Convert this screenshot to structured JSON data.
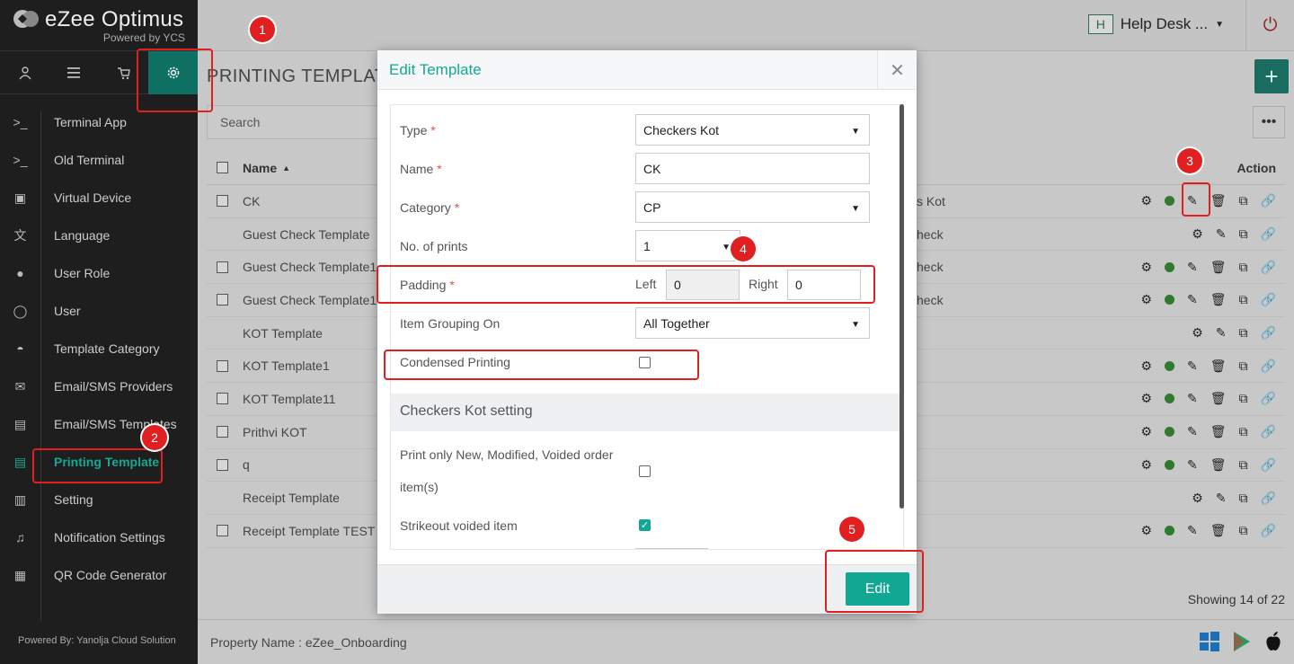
{
  "brand": {
    "name": "eZee Optimus",
    "tagline": "Powered by YCS",
    "powered_by": "Powered By: Yanolja Cloud Solution"
  },
  "top_tabs": [
    {
      "icon": "user-icon"
    },
    {
      "icon": "menu-icon"
    },
    {
      "icon": "cart-icon"
    },
    {
      "icon": "gear-icon",
      "active": true
    }
  ],
  "sidebar": {
    "items": [
      {
        "label": "Terminal App",
        "icon": "terminal-icon"
      },
      {
        "label": "Old Terminal",
        "icon": "terminal-icon"
      },
      {
        "label": "Virtual Device",
        "icon": "tablet-icon"
      },
      {
        "label": "Language",
        "icon": "language-icon"
      },
      {
        "label": "User Role",
        "icon": "user-role-icon"
      },
      {
        "label": "User",
        "icon": "user-icon"
      },
      {
        "label": "Template Category",
        "icon": "inbox-icon"
      },
      {
        "label": "Email/SMS Providers",
        "icon": "mail-icon"
      },
      {
        "label": "Email/SMS Templates",
        "icon": "film-icon"
      },
      {
        "label": "Printing Template",
        "icon": "document-icon",
        "active": true
      },
      {
        "label": "Setting",
        "icon": "sliders-icon"
      },
      {
        "label": "Notification Settings",
        "icon": "bell-icon"
      },
      {
        "label": "QR Code Generator",
        "icon": "qr-icon"
      }
    ]
  },
  "header": {
    "helpdesk_badge": "H",
    "helpdesk_label": "Help Desk ..."
  },
  "page": {
    "title": "PRINTING TEMPLATE",
    "search_placeholder": "Search",
    "col_name": "Name",
    "col_action": "Action",
    "showing": "Showing 14 of 22",
    "property": "Property Name : eZee_Onboarding"
  },
  "rows": [
    {
      "name": "CK",
      "type": "s Kot",
      "checkbox": true,
      "full": true
    },
    {
      "name": "Guest Check Template",
      "type": "heck",
      "checkbox": false,
      "full": false
    },
    {
      "name": "Guest Check Template1",
      "type": "heck",
      "checkbox": true,
      "full": true
    },
    {
      "name": "Guest Check Template1",
      "type": "heck",
      "checkbox": true,
      "full": true
    },
    {
      "name": "KOT Template",
      "type": "",
      "checkbox": false,
      "full": false
    },
    {
      "name": "KOT Template1",
      "type": "",
      "checkbox": true,
      "full": true
    },
    {
      "name": "KOT Template11",
      "type": "",
      "checkbox": true,
      "full": true
    },
    {
      "name": "Prithvi KOT",
      "type": "",
      "checkbox": true,
      "full": true
    },
    {
      "name": "q",
      "type": "",
      "checkbox": true,
      "full": true
    },
    {
      "name": "Receipt Template",
      "type": "",
      "checkbox": false,
      "full": false
    },
    {
      "name": "Receipt Template TEST",
      "type": "",
      "checkbox": true,
      "full": true
    }
  ],
  "modal": {
    "title": "Edit Template",
    "type_label": "Type",
    "type_value": "Checkers Kot",
    "name_label": "Name",
    "name_value": "CK",
    "category_label": "Category",
    "category_value": "CP",
    "prints_label": "No. of prints",
    "prints_value": "1",
    "padding_label": "Padding",
    "left_label": "Left",
    "left_value": "0",
    "right_label": "Right",
    "right_value": "0",
    "grouping_label": "Item Grouping On",
    "grouping_value": "All Together",
    "condensed_label": "Condensed Printing",
    "condensed_checked": false,
    "section_title": "Checkers Kot setting",
    "print_only_label_1": "Print only New, Modified, Voided order",
    "print_only_label_2": "item(s)",
    "print_only_checked": false,
    "strikeout_label": "Strikeout voided item",
    "strikeout_checked": true,
    "edit_button": "Edit"
  },
  "annotations": [
    "1",
    "2",
    "3",
    "4",
    "5"
  ]
}
